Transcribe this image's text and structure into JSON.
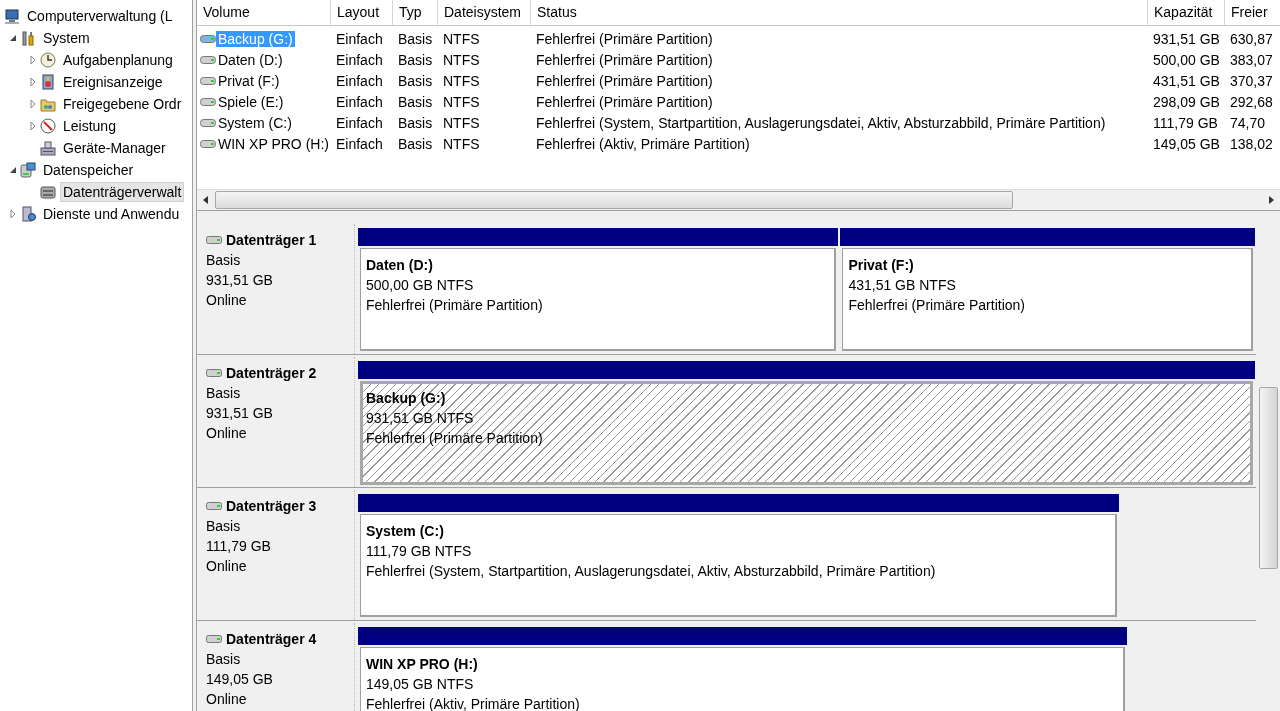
{
  "tree": [
    {
      "label": "Computerverwaltung (L",
      "selected": false,
      "children": [
        {
          "label": "System",
          "expanded": true,
          "selected": false,
          "children": [
            {
              "label": "Aufgabenplanung",
              "expanded": false,
              "selected": false
            },
            {
              "label": "Ereignisanzeige",
              "expanded": false,
              "selected": false
            },
            {
              "label": "Freigegebene Ordr",
              "expanded": false,
              "selected": false
            },
            {
              "label": "Leistung",
              "expanded": false,
              "selected": false
            },
            {
              "label": "Geräte-Manager",
              "selected": false
            }
          ]
        },
        {
          "label": "Datenspeicher",
          "expanded": true,
          "selected": false,
          "children": [
            {
              "label": "Datenträgerverwalt",
              "selected": true
            }
          ]
        },
        {
          "label": "Dienste und Anwendu",
          "expanded": false,
          "selected": false
        }
      ]
    }
  ],
  "volume_table": {
    "columns": [
      "Volume",
      "Layout",
      "Typ",
      "Dateisystem",
      "Status",
      "Kapazität",
      "Freier"
    ],
    "rows": [
      {
        "selected": true,
        "cells": [
          "Backup (G:)",
          "Einfach",
          "Basis",
          "NTFS",
          "Fehlerfrei (Primäre Partition)",
          "931,51 GB",
          "630,87"
        ]
      },
      {
        "selected": false,
        "cells": [
          "Daten (D:)",
          "Einfach",
          "Basis",
          "NTFS",
          "Fehlerfrei (Primäre Partition)",
          "500,00 GB",
          "383,07"
        ]
      },
      {
        "selected": false,
        "cells": [
          "Privat (F:)",
          "Einfach",
          "Basis",
          "NTFS",
          "Fehlerfrei (Primäre Partition)",
          "431,51 GB",
          "370,37"
        ]
      },
      {
        "selected": false,
        "cells": [
          "Spiele (E:)",
          "Einfach",
          "Basis",
          "NTFS",
          "Fehlerfrei (Primäre Partition)",
          "298,09 GB",
          "292,68"
        ]
      },
      {
        "selected": false,
        "cells": [
          "System (C:)",
          "Einfach",
          "Basis",
          "NTFS",
          "Fehlerfrei (System, Startpartition, Auslagerungsdatei, Aktiv, Absturzabbild, Primäre Partition)",
          "111,79 GB",
          "74,70"
        ]
      },
      {
        "selected": false,
        "cells": [
          "WIN XP PRO (H:)",
          "Einfach",
          "Basis",
          "NTFS",
          "Fehlerfrei (Aktiv, Primäre Partition)",
          "149,05 GB",
          "138,02"
        ]
      }
    ]
  },
  "disks": [
    {
      "name": "Datenträger 1",
      "type": "Basis",
      "size": "931,51 GB",
      "state": "Online",
      "partitions": [
        {
          "name": "Daten  (D:)",
          "size": "500,00 GB NTFS",
          "status": "Fehlerfrei (Primäre Partition)",
          "selected": false
        },
        {
          "name": "Privat  (F:)",
          "size": "431,51 GB NTFS",
          "status": "Fehlerfrei (Primäre Partition)",
          "selected": false
        }
      ]
    },
    {
      "name": "Datenträger 2",
      "type": "Basis",
      "size": "931,51 GB",
      "state": "Online",
      "partitions": [
        {
          "name": "Backup  (G:)",
          "size": "931,51 GB NTFS",
          "status": "Fehlerfrei (Primäre Partition)",
          "selected": true
        }
      ]
    },
    {
      "name": "Datenträger 3",
      "type": "Basis",
      "size": "111,79 GB",
      "state": "Online",
      "partitions": [
        {
          "name": "System  (C:)",
          "size": "111,79 GB NTFS",
          "status": "Fehlerfrei (System, Startpartition, Auslagerungsdatei, Aktiv, Absturzabbild, Primäre Partition)",
          "selected": false
        }
      ]
    },
    {
      "name": "Datenträger 4",
      "type": "Basis",
      "size": "149,05 GB",
      "state": "Online",
      "partitions": [
        {
          "name": "WIN XP PRO  (H:)",
          "size": "149,05 GB NTFS",
          "status": "Fehlerfrei (Aktiv, Primäre Partition)",
          "selected": false
        }
      ]
    }
  ]
}
